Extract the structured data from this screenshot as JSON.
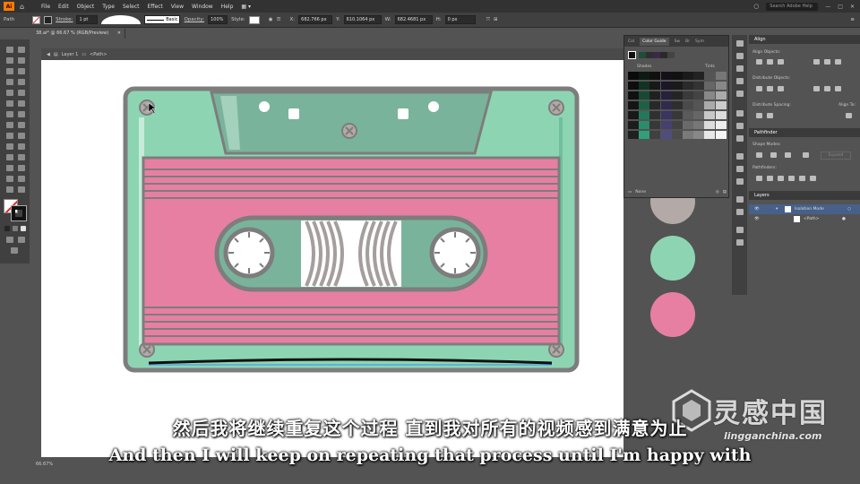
{
  "app": {
    "logo": "Ai",
    "menu": [
      "File",
      "Edit",
      "Object",
      "Type",
      "Select",
      "Effect",
      "View",
      "Window",
      "Help"
    ],
    "search_placeholder": "Search Adobe Help"
  },
  "controlbar": {
    "selection": "Path",
    "stroke_label": "Stroke:",
    "stroke_value": "1 pt",
    "brush_label": "Basic",
    "opacity_label": "Opacity:",
    "opacity_value": "100%",
    "style_label": "Style:",
    "x_value": "682.766 px",
    "y_value": "610.1064 px",
    "w_value": "682.4681 px",
    "h_value": "0 px"
  },
  "document": {
    "tab_title": "38.ai* @ 66.67 % (RGB/Preview)",
    "breadcrumb_layer": "Layer 1",
    "breadcrumb_path": "<Path>",
    "zoom": "66.67%"
  },
  "color_panel": {
    "tabs": [
      "Col",
      "Color Guide",
      "Sw",
      "Br",
      "Sym"
    ],
    "active_tab": "Color Guide",
    "shades_label": "Shades",
    "tints_label": "Tints",
    "footer_label": "None"
  },
  "right_panels": {
    "align": {
      "title": "Align",
      "align_objects": "Align Objects:",
      "distribute_objects": "Distribute Objects:",
      "distribute_spacing": "Distribute Spacing:",
      "align_to": "Align To:"
    },
    "pathfinder": {
      "title": "Pathfinder",
      "shape_modes": "Shape Modes:",
      "pathfinders": "Pathfinders:",
      "expand": "Expand"
    },
    "layers": {
      "title": "Layers",
      "rows": [
        "Isolation Mode",
        "<Path>"
      ]
    }
  },
  "subtitles": {
    "chinese": "然后我将继续重复这个过程 直到我对所有的视频感到满意为止",
    "english": "And then I will keep on repeating that process until I'm happy with"
  },
  "watermark": {
    "name": "灵感中国",
    "url": "lingganchina.com"
  },
  "colors": {
    "mint": "#8dd5b2",
    "pink": "#e77fa3",
    "grey": "#b3aaa7",
    "dark_grey": "#7d7d7d",
    "teal_dark": "#7ab39b",
    "canvas": "#ffffff",
    "ui_dark": "#535353"
  }
}
